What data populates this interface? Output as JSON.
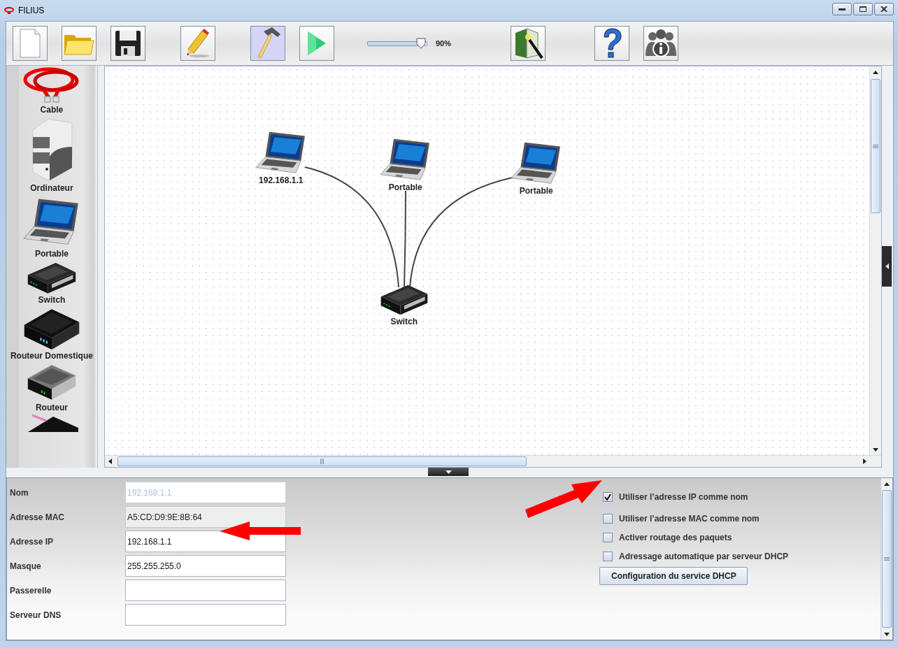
{
  "window": {
    "title": "FILIUS"
  },
  "toolbar": [
    {
      "kind": "new",
      "selected": false
    },
    {
      "kind": "open",
      "selected": false
    },
    {
      "kind": "save",
      "selected": false
    },
    {
      "kind": "edit",
      "selected": false
    },
    {
      "kind": "design",
      "selected": true
    },
    {
      "kind": "simulate",
      "selected": false
    },
    {
      "kind": "zoom",
      "level": 0.9,
      "reading": "90%"
    },
    {
      "kind": "wizard",
      "selected": false
    },
    {
      "kind": "help",
      "selected": false
    },
    {
      "kind": "info",
      "selected": false
    }
  ],
  "palette": [
    {
      "kind": "cable",
      "label": "Cable"
    },
    {
      "kind": "computer",
      "label": "Ordinateur"
    },
    {
      "kind": "laptop",
      "label": "Portable"
    },
    {
      "kind": "switch",
      "label": "Switch"
    },
    {
      "kind": "homerouter",
      "label": "Routeur Domestique"
    },
    {
      "kind": "router",
      "label": "Routeur"
    }
  ],
  "canvas": {
    "nodes": [
      {
        "kind": "laptop",
        "label": "192.168.1.1"
      },
      {
        "kind": "laptop",
        "label": "Portable"
      },
      {
        "kind": "laptop",
        "label": "Portable"
      },
      {
        "kind": "switch",
        "label": "Switch"
      }
    ]
  },
  "config": {
    "fields": [
      {
        "kind": "input",
        "label": "Nom",
        "value": "192.168.1.1",
        "disabled": true
      },
      {
        "kind": "readonly",
        "label": "Adresse MAC",
        "value": "A5:CD:D9:9E:8B:64",
        "disabled": false
      },
      {
        "kind": "input",
        "label": "Adresse IP",
        "value": "192.168.1.1",
        "disabled": false
      },
      {
        "kind": "input",
        "label": "Masque",
        "value": "255.255.255.0",
        "disabled": false
      },
      {
        "kind": "input",
        "label": "Passerelle",
        "disabled": false
      },
      {
        "kind": "input",
        "label": "Serveur DNS",
        "disabled": false
      }
    ],
    "options": [
      {
        "label": "Utiliser l’adresse IP comme nom",
        "checked": true
      },
      {
        "label": "Utiliser l’adresse MAC comme nom",
        "checked": false
      },
      {
        "label": "Activer routage des paquets",
        "checked": false
      },
      {
        "label": "Adressage automatique par serveur DHCP",
        "checked": false
      }
    ],
    "button": "Configuration du service DHCP"
  }
}
